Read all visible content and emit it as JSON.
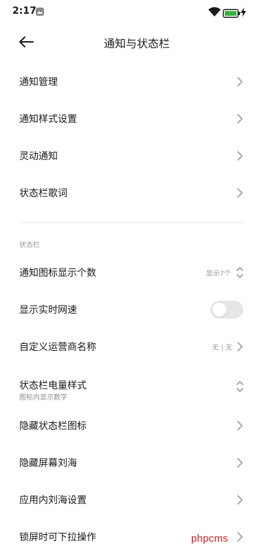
{
  "status_bar": {
    "time": "2:17",
    "app_icon": "gallery-icon",
    "wifi_icon": "wifi-icon",
    "battery_icon": "battery-icon",
    "charging_icon": "charging-bolt-icon",
    "battery_color": "#3cb043"
  },
  "header": {
    "back_icon": "back-arrow-icon",
    "title": "通知与状态栏"
  },
  "group1": {
    "items": [
      {
        "label": "通知管理"
      },
      {
        "label": "通知样式设置"
      },
      {
        "label": "灵动通知"
      },
      {
        "label": "状态栏歌词"
      }
    ]
  },
  "section": {
    "title": "状态栏"
  },
  "group2": {
    "notif_icon_count": {
      "label": "通知图标显示个数",
      "value": "显示7个"
    },
    "realtime_speed": {
      "label": "显示实时网速",
      "enabled": false
    },
    "carrier_name": {
      "label": "自定义运营商名称",
      "value": "无 | 无"
    },
    "battery_style": {
      "label": "状态栏电量样式",
      "sublabel": "图标内显示数字"
    },
    "hide_icons": {
      "label": "隐藏状态栏图标"
    },
    "hide_notch": {
      "label": "隐藏屏幕刘海"
    },
    "app_notch": {
      "label": "应用内刘海设置"
    },
    "lockscreen_pulldown": {
      "label": "锁屏时可下拉操作"
    }
  },
  "watermark": "phpcms"
}
